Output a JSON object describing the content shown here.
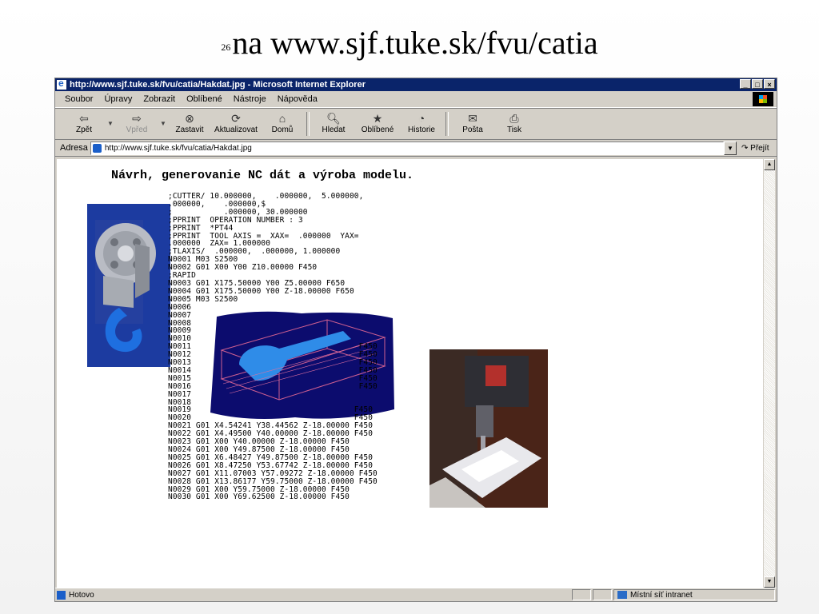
{
  "slide": {
    "number": "26",
    "title": "na www.sjf.tuke.sk/fvu/catia"
  },
  "window": {
    "title": "http://www.sjf.tuke.sk/fvu/catia/Hakdat.jpg - Microsoft Internet Explorer",
    "controls": [
      "_",
      "□",
      "×"
    ]
  },
  "menu": [
    "Soubor",
    "Úpravy",
    "Zobrazit",
    "Oblíbené",
    "Nástroje",
    "Nápověda"
  ],
  "toolbar": {
    "back": "Zpět",
    "forward": "Vpřed",
    "stop": "Zastavit",
    "refresh": "Aktualizovat",
    "home": "Domů",
    "search": "Hledat",
    "favorites": "Oblíbené",
    "history": "Historie",
    "mail": "Pošta",
    "print": "Tisk"
  },
  "address": {
    "label": "Adresa",
    "url": "http://www.sjf.tuke.sk/fvu/catia/Hakdat.jpg",
    "go": "Přejít"
  },
  "content": {
    "heading": "Návrh, generovanie NC dát a výroba modelu.",
    "code": ";CUTTER/ 10.000000,    .000000,  5.000000,\n.000000,    .000000,$\n;           .000000, 30.000000\n;PPRINT  OPERATION NUMBER : 3\n;PPRINT  *PT44\n;PPRINT  TOOL AXIS =  XAX=  .000000  YAX=\n.000000  ZAX= 1.000000\n;TLAXIS/  .000000,  .000000, 1.000000\nN0001 M03 S2500\nN0002 G01 X00 Y00 Z10.00000 F450\n;RAPID\nN0003 G01 X175.50000 Y00 Z5.00000 F650\nN0004 G01 X175.50000 Y00 Z-18.00000 F650\nN0005 M03 S2500\nN0006\nN0007\nN0008\nN0009\nN0010\nN0011                                    F450\nN0012                                    F450\nN0013                                    F450\nN0014                                    F450\nN0015                                    F450\nN0016                                    F450\nN0017\nN0018\nN0019                                   F450\nN0020                                   F450\nN0021 G01 X4.54241 Y38.44562 Z-18.00000 F450\nN0022 G01 X4.49500 Y40.00000 Z-18.00000 F450\nN0023 G01 X00 Y40.00000 Z-18.00000 F450\nN0024 G01 X00 Y49.87500 Z-18.00000 F450\nN0025 G01 X6.48427 Y49.87500 Z-18.00000 F450\nN0026 G01 X8.47250 Y53.67742 Z-18.00000 F450\nN0027 G01 X11.07003 Y57.09272 Z-18.00000 F450\nN0028 G01 X13.86177 Y59.75000 Z-18.00000 F450\nN0029 G01 X00 Y59.75000 Z-18.00000 F450\nN0030 G01 X00 Y69.62500 Z-18.00000 F450"
  },
  "status": {
    "text": "Hotovo",
    "zone": "Místní síť intranet"
  }
}
